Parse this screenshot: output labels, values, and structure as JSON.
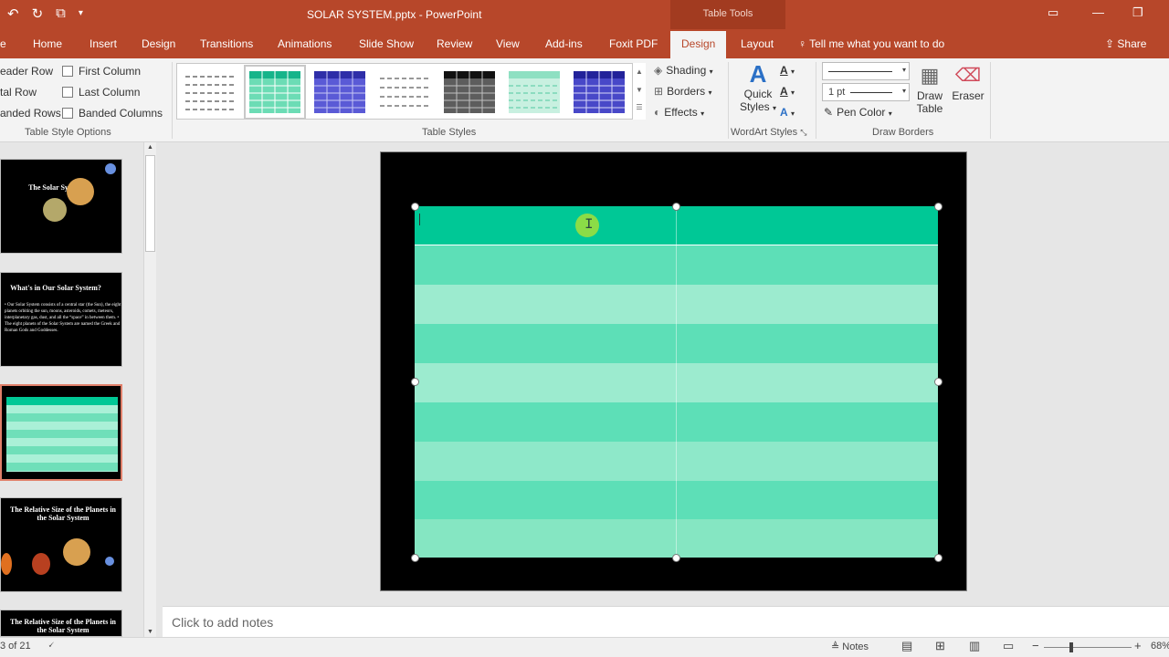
{
  "titlebar": {
    "title": "SOLAR SYSTEM.pptx  -  PowerPoint",
    "tools_label": "Table Tools"
  },
  "tabs": [
    {
      "label": "e"
    },
    {
      "label": "Home"
    },
    {
      "label": "Insert"
    },
    {
      "label": "Design"
    },
    {
      "label": "Transitions"
    },
    {
      "label": "Animations"
    },
    {
      "label": "Slide Show"
    },
    {
      "label": "Review"
    },
    {
      "label": "View"
    },
    {
      "label": "Add-ins"
    },
    {
      "label": "Foxit PDF"
    },
    {
      "label": "Design"
    },
    {
      "label": "Layout"
    }
  ],
  "tellme": "Tell me what you want to do",
  "share": "Share",
  "ribbon": {
    "style_options": {
      "header_row": "eader Row",
      "first_column": "First Column",
      "total_row": "tal Row",
      "last_column": "Last Column",
      "banded_rows": "anded Rows",
      "banded_columns": "Banded Columns",
      "group_label": "Table Style Options"
    },
    "table_styles": {
      "group_label": "Table Styles",
      "shading": "Shading",
      "borders": "Borders",
      "effects": "Effects"
    },
    "wordart": {
      "quick": "Quick",
      "styles": "Styles",
      "group_label": "WordArt Styles"
    },
    "draw_borders": {
      "pen_weight": "1 pt",
      "pen_color": "Pen Color",
      "draw": "Draw",
      "table": "Table",
      "eraser": "Eraser",
      "group_label": "Draw Borders"
    }
  },
  "thumbnails": [
    {
      "title": "The Solar System",
      "body": ""
    },
    {
      "title": "What's in Our Solar System?",
      "body": "• Our Solar System consists of a central star (the Sun), the eight planets orbiting the sun, moons, asteroids, comets, meteors, interplanetary gas, dust, and all the “space” in between them.  • The eight planets of the Solar System are named the Greek and Roman Gods and Goddesses."
    },
    {
      "title": "",
      "body": ""
    },
    {
      "title": "The Relative Size of the Planets in the Solar System",
      "body": ""
    },
    {
      "title": "The Relative Size of the Planets in the Solar System",
      "body": ""
    }
  ],
  "notes_placeholder": "Click to add notes",
  "status": {
    "slide": "3 of 21",
    "notes": "Notes",
    "zoom": "68%"
  },
  "colors": {
    "accent": "#b7472a",
    "table_header": "#00c896",
    "table_band_dark": "#55ddb4",
    "table_band_light": "#99ebcd"
  }
}
